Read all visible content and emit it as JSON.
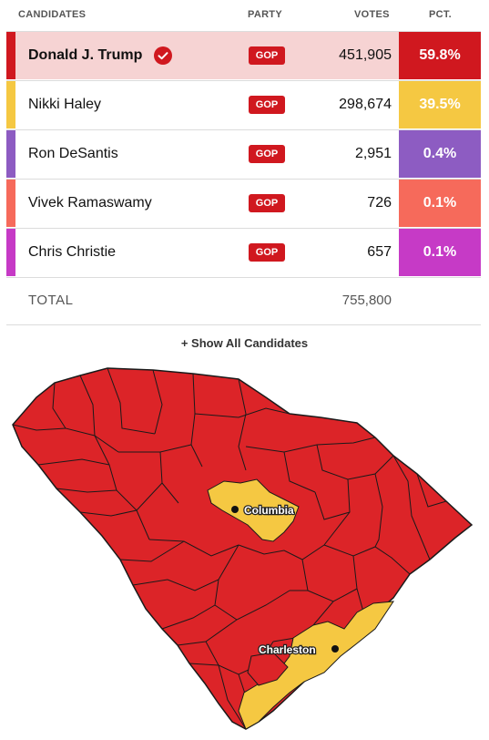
{
  "header": {
    "candidates": "CANDIDATES",
    "party": "PARTY",
    "votes": "VOTES",
    "pct": "PCT."
  },
  "candidates": [
    {
      "name": "Donald J. Trump",
      "party": "GOP",
      "votes": "451,905",
      "pct": "59.8%",
      "color": "#d0181f",
      "winner": true
    },
    {
      "name": "Nikki Haley",
      "party": "GOP",
      "votes": "298,674",
      "pct": "39.5%",
      "color": "#f5c842",
      "winner": false
    },
    {
      "name": "Ron DeSantis",
      "party": "GOP",
      "votes": "2,951",
      "pct": "0.4%",
      "color": "#8d5cc2",
      "winner": false
    },
    {
      "name": "Vivek Ramaswamy",
      "party": "GOP",
      "votes": "726",
      "pct": "0.1%",
      "color": "#f66a5b",
      "winner": false
    },
    {
      "name": "Chris Christie",
      "party": "GOP",
      "votes": "657",
      "pct": "0.1%",
      "color": "#c63ac6",
      "winner": false
    }
  ],
  "total": {
    "label": "TOTAL",
    "votes": "755,800"
  },
  "show_all_label": "+ Show All Candidates",
  "map": {
    "cities": [
      {
        "name": "Columbia"
      },
      {
        "name": "Charleston"
      }
    ],
    "colors": {
      "trump": "#dc2428",
      "haley": "#f5c842",
      "border": "#1a1a1a"
    }
  }
}
